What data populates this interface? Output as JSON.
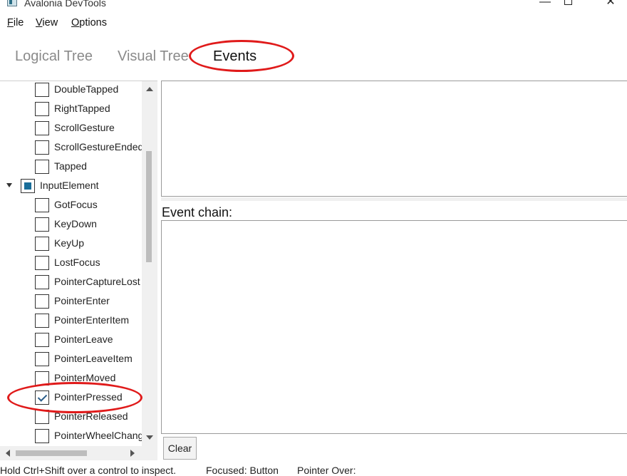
{
  "window": {
    "title": "Avalonia DevTools"
  },
  "menu": [
    {
      "acc": "F",
      "rest": "ile"
    },
    {
      "acc": "V",
      "rest": "iew"
    },
    {
      "acc": "O",
      "rest": "ptions"
    }
  ],
  "tabs": [
    {
      "label": "Logical Tree",
      "active": false
    },
    {
      "label": "Visual Tree",
      "active": false
    },
    {
      "label": "Events",
      "active": true
    }
  ],
  "tree": {
    "items": [
      {
        "label": "DoubleTapped",
        "level": 1,
        "state": "unchecked"
      },
      {
        "label": "RightTapped",
        "level": 1,
        "state": "unchecked"
      },
      {
        "label": "ScrollGesture",
        "level": 1,
        "state": "unchecked"
      },
      {
        "label": "ScrollGestureEnded",
        "level": 1,
        "state": "unchecked"
      },
      {
        "label": "Tapped",
        "level": 1,
        "state": "unchecked"
      },
      {
        "label": "InputElement",
        "level": 0,
        "state": "indeterminate",
        "expanded": true
      },
      {
        "label": "GotFocus",
        "level": 1,
        "state": "unchecked"
      },
      {
        "label": "KeyDown",
        "level": 1,
        "state": "unchecked"
      },
      {
        "label": "KeyUp",
        "level": 1,
        "state": "unchecked"
      },
      {
        "label": "LostFocus",
        "level": 1,
        "state": "unchecked"
      },
      {
        "label": "PointerCaptureLost",
        "level": 1,
        "state": "unchecked"
      },
      {
        "label": "PointerEnter",
        "level": 1,
        "state": "unchecked"
      },
      {
        "label": "PointerEnterItem",
        "level": 1,
        "state": "unchecked"
      },
      {
        "label": "PointerLeave",
        "level": 1,
        "state": "unchecked"
      },
      {
        "label": "PointerLeaveItem",
        "level": 1,
        "state": "unchecked"
      },
      {
        "label": "PointerMoved",
        "level": 1,
        "state": "unchecked"
      },
      {
        "label": "PointerPressed",
        "level": 1,
        "state": "checked"
      },
      {
        "label": "PointerReleased",
        "level": 1,
        "state": "unchecked"
      },
      {
        "label": "PointerWheelChanged",
        "level": 1,
        "state": "unchecked"
      }
    ]
  },
  "details": {
    "event_chain_label": "Event chain:",
    "clear_label": "Clear"
  },
  "status": {
    "hint": "Hold Ctrl+Shift over a control to inspect.",
    "focused": "Focused: Button",
    "pointer_over": "Pointer Over:"
  },
  "colors": {
    "annotation": "#e01a1a",
    "check_accent": "#1a6e9a"
  }
}
